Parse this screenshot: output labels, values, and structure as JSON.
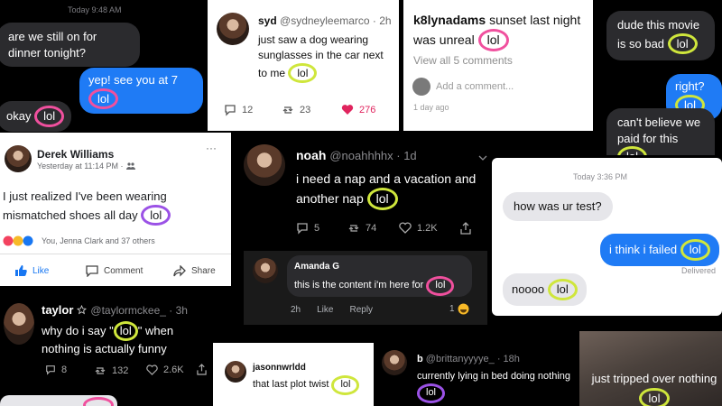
{
  "imessage_top": {
    "timestamp": "Today 9:48 AM",
    "msg1": "are we still on for dinner tonight?",
    "msg2_pre": "yep! see you at 7",
    "msg2_lol": "lol",
    "msg3_pre": "okay",
    "msg3_lol": "lol"
  },
  "syd_tweet": {
    "name": "syd",
    "handle": "@sydneyleemarco · 2h",
    "text_pre": "just saw a dog wearing sunglasses in the car next to me",
    "lol": "lol",
    "replies": "12",
    "retweets": "23",
    "likes": "276"
  },
  "insta_comment": {
    "username": "k8lynadams",
    "text_pre": "sunset last night was unreal",
    "lol": "lol",
    "view_all": "View all 5 comments",
    "add_comment": "Add a comment...",
    "time": "1 day ago"
  },
  "imessage_right": {
    "msg1_pre": "dude this movie is so bad",
    "msg1_lol": "lol",
    "msg2_pre": "right?",
    "msg2_lol": "lol",
    "msg3_pre": "can't believe we paid for this",
    "msg3_lol": "lol"
  },
  "fb_post": {
    "name": "Derek Williams",
    "time": "Yesterday at 11:14 PM ·",
    "text_pre": "I just realized I've been wearing mismatched shoes all day",
    "lol": "lol",
    "reactions": "You, Jenna Clark and 37 others",
    "like": "Like",
    "comment": "Comment",
    "share": "Share",
    "more": "···"
  },
  "noah_tweet": {
    "name": "noah",
    "handle": "@noahhhhx · 1d",
    "text_pre": "i need a nap and a vacation and another nap",
    "lol": "lol",
    "replies": "5",
    "retweets": "74",
    "likes": "1.2K"
  },
  "imessage_center": {
    "timestamp": "Today 3:36 PM",
    "msg1": "how was ur test?",
    "msg2_pre": "i think i failed",
    "msg2_lol": "lol",
    "delivered": "Delivered",
    "msg3_pre": "noooo",
    "msg3_lol": "lol"
  },
  "amanda_comment": {
    "name": "Amanda G",
    "text_pre": "this is the content i'm here for",
    "lol": "lol",
    "time": "2h",
    "like": "Like",
    "reply": "Reply",
    "reaction_count": "1"
  },
  "taylor_tweet": {
    "name": "taylor",
    "handle": "@taylormckee_ · 3h",
    "text_pre": "why do i say \"",
    "lol": "lol",
    "text_post": "\" when nothing is actually funny",
    "replies": "8",
    "retweets": "132",
    "likes": "2.6K"
  },
  "jason_comment": {
    "username": "jasonnwrldd",
    "text_pre": "that last plot twist",
    "lol": "lol"
  },
  "b_tweet": {
    "name": "b",
    "handle": "@brittanyyyye_ · 18h",
    "text_pre": "currently lying in bed doing nothing",
    "lol": "lol"
  },
  "photo_caption": {
    "text_pre": "just tripped over nothing",
    "lol": "lol"
  },
  "colors": {
    "pink": "#f0509e",
    "yellow": "#cfe63c",
    "purple": "#9b52e6",
    "imessage_blue": "#1f7bf5",
    "fb_blue": "#1877f2",
    "heart_red": "#e0245e"
  }
}
